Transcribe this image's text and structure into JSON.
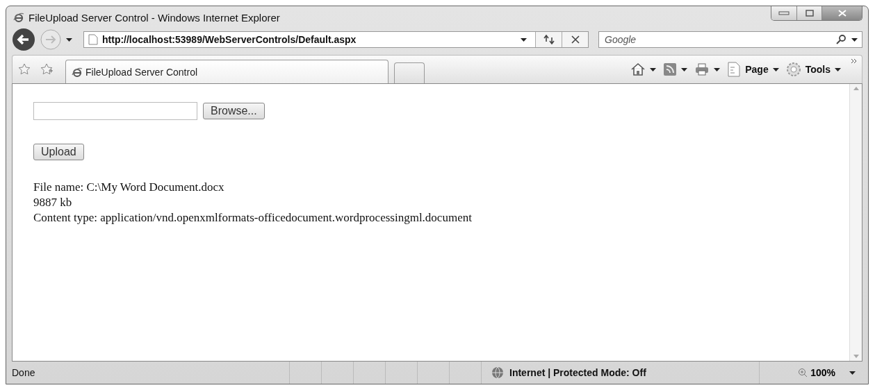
{
  "window": {
    "title": "FileUpload Server Control - Windows Internet Explorer"
  },
  "address_bar": {
    "url": "http://localhost:53989/WebServerControls/Default.aspx"
  },
  "search": {
    "placeholder": "Google"
  },
  "tabs": [
    {
      "label": "FileUpload Server Control",
      "selected": true
    },
    {
      "selected": false
    }
  ],
  "command_bar": {
    "page_label": "Page",
    "tools_label": "Tools"
  },
  "page": {
    "browse_button": "Browse...",
    "upload_button": "Upload",
    "lines": [
      "File name: C:\\My Word Document.docx",
      "9887 kb",
      "Content type: application/vnd.openxmlformats-officedocument.wordprocessingml.document"
    ]
  },
  "status_bar": {
    "status": "Done",
    "zone": "Internet | Protected Mode: Off",
    "zoom": "100%"
  }
}
